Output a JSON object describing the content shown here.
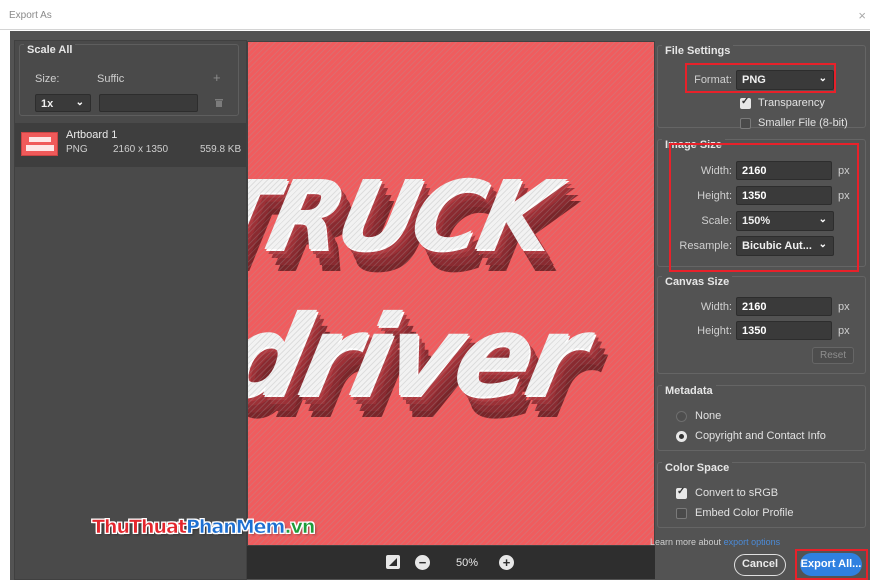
{
  "window": {
    "title": "Export As",
    "close_glyph": "×"
  },
  "scale_all": {
    "legend": "Scale All",
    "size_label": "Size:",
    "suffix_label": "Suffic",
    "add_glyph": "+",
    "scale_value": "1x",
    "suffix_value": ""
  },
  "artboard": {
    "name": "Artboard 1",
    "format": "PNG",
    "dimensions": "2160 x 1350",
    "file_size": "559.8 KB"
  },
  "preview": {
    "line1": "TRUCK",
    "line2": "driver",
    "zoom": "50%",
    "zoom_out_glyph": "−",
    "zoom_in_glyph": "+"
  },
  "file_settings": {
    "legend": "File Settings",
    "format_label": "Format:",
    "format_value": "PNG",
    "transparency_label": "Transparency",
    "transparency_checked": true,
    "smaller_file_label": "Smaller File (8-bit)",
    "smaller_file_checked": false
  },
  "image_size": {
    "legend": "Image Size",
    "width_label": "Width:",
    "width_value": "2160",
    "height_label": "Height:",
    "height_value": "1350",
    "scale_label": "Scale:",
    "scale_value": "150%",
    "resample_label": "Resample:",
    "resample_value": "Bicubic Aut...",
    "unit": "px"
  },
  "canvas_size": {
    "legend": "Canvas Size",
    "width_label": "Width:",
    "width_value": "2160",
    "height_label": "Height:",
    "height_value": "1350",
    "unit": "px",
    "reset_label": "Reset"
  },
  "metadata": {
    "legend": "Metadata",
    "none_label": "None",
    "copyright_label": "Copyright and Contact Info",
    "selected": "copyright"
  },
  "color_space": {
    "legend": "Color Space",
    "convert_label": "Convert to sRGB",
    "convert_checked": true,
    "embed_label": "Embed Color Profile",
    "embed_checked": false
  },
  "footer": {
    "learn_text": "Learn more about",
    "learn_link": "export options",
    "cancel_label": "Cancel",
    "export_label": "Export All..."
  },
  "watermark": {
    "part1": "Thu",
    "part2": "Thuat",
    "part3": "PhanMem",
    "part4": ".vn"
  },
  "colors": {
    "accent": "#2f80e0",
    "highlight_box": "#e8212a",
    "artwork_bg": "#f05c5e"
  }
}
